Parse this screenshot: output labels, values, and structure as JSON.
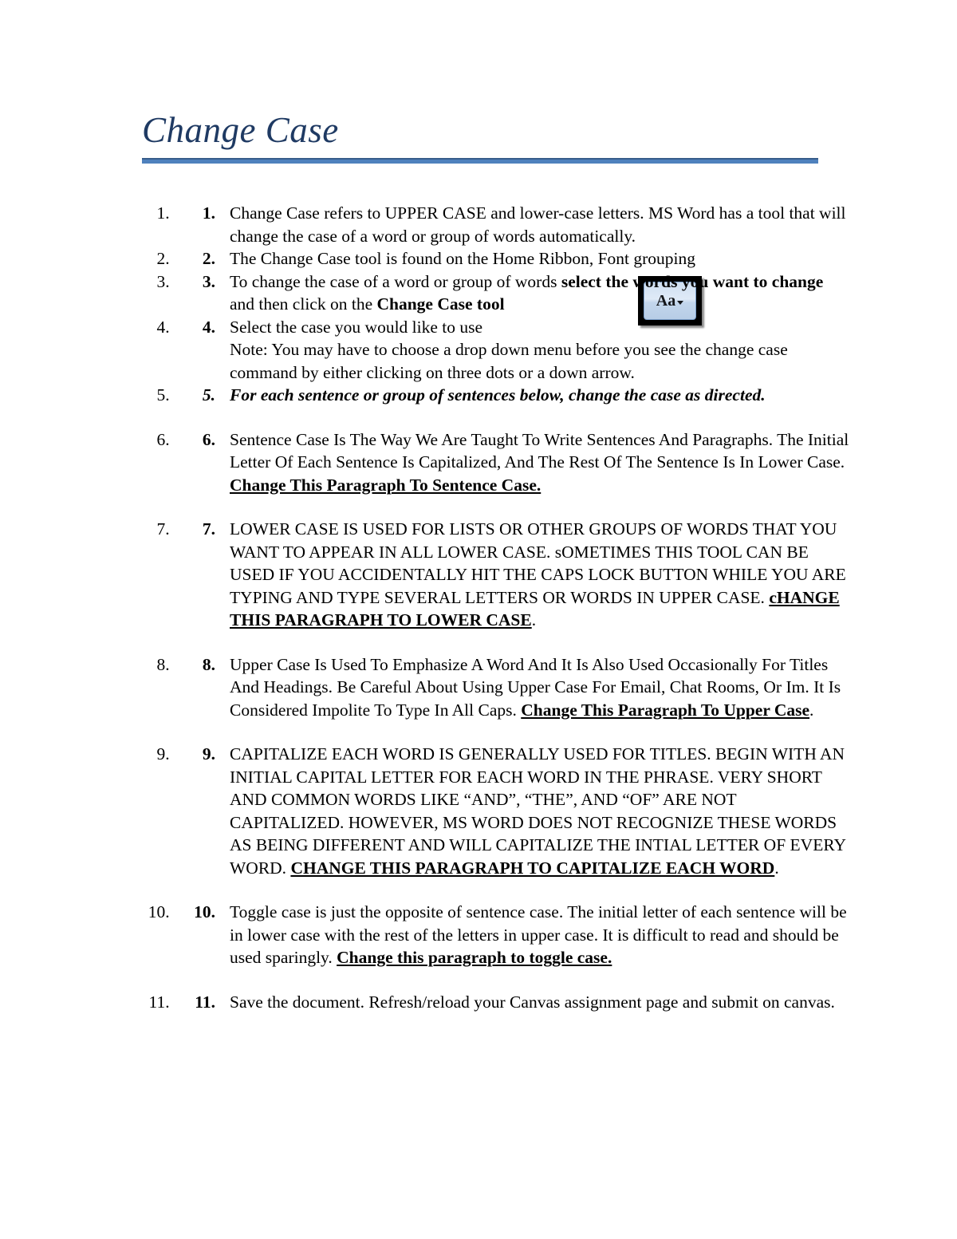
{
  "document": {
    "title": "Change Case",
    "accent_color": "#4F81BD",
    "title_color": "#1F3A63"
  },
  "tool_button": {
    "label": "Aa",
    "icon": "change-case-icon",
    "caret": "chevron-down-icon"
  },
  "list": {
    "items": [
      {
        "number": "1.",
        "text_plain": "Change Case refers to UPPER CASE and lower-case letters. MS Word has a tool that will change the case of a word or group of words automatically."
      },
      {
        "number": "2.",
        "text_plain": "The Change Case tool is found on the Home Ribbon, Font grouping"
      },
      {
        "number": "3.",
        "lead": "To change the case of a word or group of words ",
        "bold1": "select the words you want to change",
        "middle": " and then click on the ",
        "bold2": "Change Case tool"
      },
      {
        "number": "4.",
        "line1": "Select the case you would like to use",
        "line2": "Note: You may have to choose a drop down menu before you see the change case command by either clicking on three dots or a down arrow."
      },
      {
        "number": "5.",
        "text_bold_italic": "For each sentence or group of sentences below, change the case as directed."
      },
      {
        "number": "6.",
        "lead": "Sentence Case Is The Way We Are Taught To Write Sentences And Paragraphs. The Initial Letter Of Each Sentence Is Capitalized, And The Rest Of The Sentence Is In Lower Case. ",
        "emphasis": "Change This Paragraph To Sentence Case.",
        "tail": ""
      },
      {
        "number": "7.",
        "lead": "LOWER CASE IS USED FOR LISTS OR OTHER GROUPS OF WORDS THAT YOU WANT TO APPEAR IN ALL LOWER CASE. sOMETIMES THIS TOOL CAN BE USED IF YOU ACCIDENTALLY HIT THE CAPS LOCK BUTTON WHILE YOU ARE TYPING AND TYPE SEVERAL LETTERS OR WORDS IN UPPER CASE. ",
        "emphasis": "cHANGE THIS PARAGRAPH TO LOWER CASE",
        "tail": "."
      },
      {
        "number": "8.",
        "lead": "Upper Case Is Used To Emphasize A Word And It Is Also Used Occasionally For Titles And Headings. Be Careful About Using Upper Case For Email, Chat Rooms, Or Im. It Is Considered Impolite To Type In All Caps. ",
        "emphasis": "Change This Paragraph To Upper Case",
        "tail": "."
      },
      {
        "number": "9.",
        "lead": "CAPITALIZE EACH WORD IS GENERALLY USED FOR TITLES. BEGIN WITH AN INITIAL CAPITAL LETTER FOR EACH WORD IN THE PHRASE. VERY SHORT AND COMMON WORDS LIKE “AND”, “THE”, AND “OF” ARE NOT CAPITALIZED. HOWEVER, MS WORD DOES NOT RECOGNIZE THESE WORDS AS BEING DIFFERENT AND WILL CAPITALIZE THE INTIAL LETTER OF EVERY WORD. ",
        "emphasis": "CHANGE THIS PARAGRAPH TO CAPITALIZE EACH WORD",
        "tail": "."
      },
      {
        "number": "10.",
        "lead": "Toggle case is just the opposite of sentence case. The initial letter of each sentence will be in lower case with the rest of the letters in upper case. It is difficult to read and should be used sparingly. ",
        "emphasis": "Change this paragraph to toggle case.",
        "tail": ""
      },
      {
        "number": "11.",
        "text_plain": "Save the document. Refresh/reload your Canvas assignment page and submit on canvas."
      }
    ]
  }
}
